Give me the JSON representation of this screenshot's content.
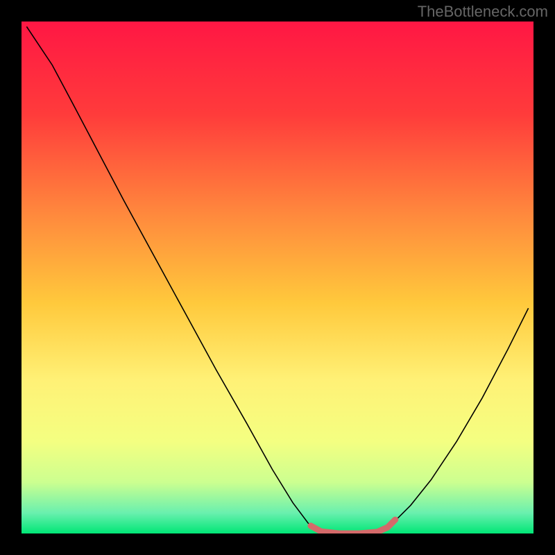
{
  "watermark": "TheBottleneck.com",
  "chart_data": {
    "type": "line",
    "title": "",
    "xlabel": "",
    "ylabel": "",
    "xlim": [
      0,
      100
    ],
    "ylim": [
      0,
      100
    ],
    "gradient_stops": [
      {
        "offset": 0,
        "color": "#ff1744"
      },
      {
        "offset": 18,
        "color": "#ff3b3b"
      },
      {
        "offset": 38,
        "color": "#ff8a3d"
      },
      {
        "offset": 55,
        "color": "#ffc93c"
      },
      {
        "offset": 70,
        "color": "#fff176"
      },
      {
        "offset": 82,
        "color": "#f4ff81"
      },
      {
        "offset": 90,
        "color": "#ccff90"
      },
      {
        "offset": 96,
        "color": "#69f0ae"
      },
      {
        "offset": 100,
        "color": "#00e676"
      }
    ],
    "series": [
      {
        "name": "bottleneck-curve",
        "color": "#000000",
        "stroke_width": 1.6,
        "points": [
          {
            "x": 1.0,
            "y": 99.0
          },
          {
            "x": 3.0,
            "y": 96.0
          },
          {
            "x": 6.0,
            "y": 91.5
          },
          {
            "x": 10.0,
            "y": 84.0
          },
          {
            "x": 15.0,
            "y": 74.5
          },
          {
            "x": 20.0,
            "y": 65.0
          },
          {
            "x": 26.0,
            "y": 54.0
          },
          {
            "x": 32.0,
            "y": 43.0
          },
          {
            "x": 38.0,
            "y": 32.0
          },
          {
            "x": 44.0,
            "y": 21.5
          },
          {
            "x": 49.0,
            "y": 12.5
          },
          {
            "x": 53.0,
            "y": 6.0
          },
          {
            "x": 56.0,
            "y": 2.0
          },
          {
            "x": 58.0,
            "y": 0.5
          },
          {
            "x": 62.0,
            "y": 0.0
          },
          {
            "x": 66.0,
            "y": 0.0
          },
          {
            "x": 70.0,
            "y": 0.5
          },
          {
            "x": 73.0,
            "y": 2.5
          },
          {
            "x": 76.0,
            "y": 5.5
          },
          {
            "x": 80.0,
            "y": 10.5
          },
          {
            "x": 85.0,
            "y": 18.0
          },
          {
            "x": 90.0,
            "y": 26.5
          },
          {
            "x": 95.0,
            "y": 36.0
          },
          {
            "x": 99.0,
            "y": 44.0
          }
        ]
      },
      {
        "name": "optimal-range-highlight",
        "color": "#d46a6a",
        "stroke_width": 9,
        "linecap": "round",
        "points": [
          {
            "x": 56.5,
            "y": 1.5
          },
          {
            "x": 58.5,
            "y": 0.4
          },
          {
            "x": 62.0,
            "y": 0.0
          },
          {
            "x": 66.0,
            "y": 0.0
          },
          {
            "x": 69.5,
            "y": 0.3
          },
          {
            "x": 71.5,
            "y": 1.2
          },
          {
            "x": 73.0,
            "y": 2.7
          }
        ]
      }
    ]
  }
}
